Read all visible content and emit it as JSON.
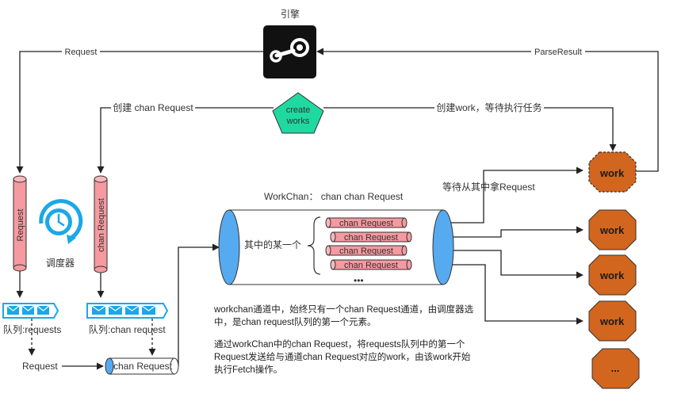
{
  "engine": {
    "label": "引擎"
  },
  "create_node": {
    "line1": "create",
    "line2": "works"
  },
  "scheduler": {
    "label": "调度器"
  },
  "edges": {
    "request_top": "Request",
    "parse_result": "ParseResult",
    "create_chan": "创建 chan Request",
    "create_work": "创建work，等待执行任务",
    "wait_take": "等待从其中拿Request",
    "request_bottom": "Request"
  },
  "pipes": {
    "request_pipe": "Request",
    "chan_request_pipe": "chan Request",
    "bottom_chan": "chan Request"
  },
  "queues": {
    "requests_label": "队列:requests",
    "chan_requests_label": "队列:chan request"
  },
  "workchan": {
    "title": "WorkChan：  chan chan Request",
    "side_label": "其中的某一个",
    "items": [
      "chan Request",
      "chan Request",
      "chan Request",
      "chan Request"
    ],
    "ellipsis": "•••"
  },
  "workers": {
    "main": "work",
    "items": [
      "work",
      "work",
      "work",
      "..."
    ]
  },
  "notes": {
    "para1": "workchan通道中，始终只有一个chan Request通道，由调度器选中，是chan request队列的第一个元素。",
    "para2": "通过workChan中的chan Request，将requests队列中的第一个Request发送给与通道chan Request对应的work，由该work开始执行Fetch操作。"
  },
  "colors": {
    "engine_bg": "#111111",
    "pentagon": "#20d9a0",
    "pink": "#f49aa0",
    "blue": "#56aaf0",
    "orange": "#d2661e",
    "queue_blue": "#1aa8e8"
  }
}
